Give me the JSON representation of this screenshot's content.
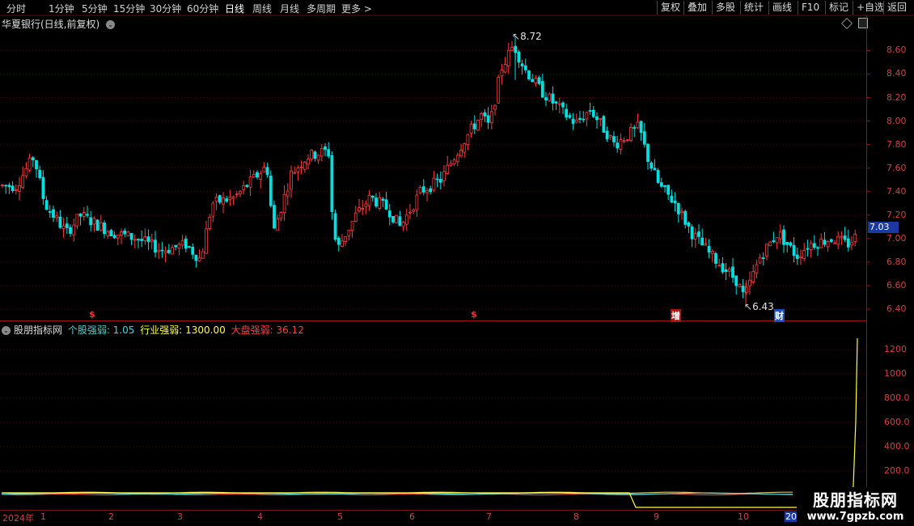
{
  "toolbar": {
    "periods": [
      "分时",
      "1分钟",
      "5分钟",
      "15分钟",
      "30分钟",
      "60分钟",
      "日线",
      "周线",
      "月线",
      "多周期",
      "更多 >"
    ],
    "active_period": "日线",
    "actions": [
      "复权",
      "叠加",
      "多股",
      "统计",
      "画线",
      "F10",
      "标记",
      "+自选",
      "返回"
    ]
  },
  "chart": {
    "title": "华夏银行(日线,前复权)",
    "price_ticks": [
      "8.60",
      "8.40",
      "8.20",
      "8.00",
      "7.80",
      "7.60",
      "7.40",
      "7.20",
      "7.00",
      "6.80",
      "6.60",
      "6.40"
    ],
    "current_price": "7.03",
    "high_label": "8.72",
    "low_label": "6.43",
    "markers": [
      {
        "text": "$",
        "color": "#ff3030"
      },
      {
        "text": "$",
        "color": "#ff3030"
      },
      {
        "text": "增",
        "color": "#ffffff"
      },
      {
        "text": "财",
        "color": "#ffffff"
      }
    ]
  },
  "indicator": {
    "name": "股朋指标网",
    "stock_label": "个股强弱:",
    "stock_value": "1.05",
    "industry_label": "行业强弱:",
    "industry_value": "1300.00",
    "market_label": "大盘强弱:",
    "market_value": "36.12",
    "ticks": [
      "1200",
      "1000",
      "800.0",
      "600.0",
      "400.0",
      "200.0"
    ]
  },
  "date_axis": {
    "year": "2024年",
    "months": [
      "1",
      "2",
      "3",
      "4",
      "5",
      "6",
      "7",
      "8",
      "9",
      "10",
      "20"
    ]
  },
  "watermark": {
    "title": "股朋指标网",
    "url": "www.7gpzb.com"
  },
  "colors": {
    "up": "#ff3c3c",
    "down": "#00e0e0",
    "grid": "#5a0000",
    "axis_text": "#d24040",
    "stock_strength": "#52d0d0",
    "industry_strength": "#ffff40",
    "market_strength": "#ff4040"
  }
}
